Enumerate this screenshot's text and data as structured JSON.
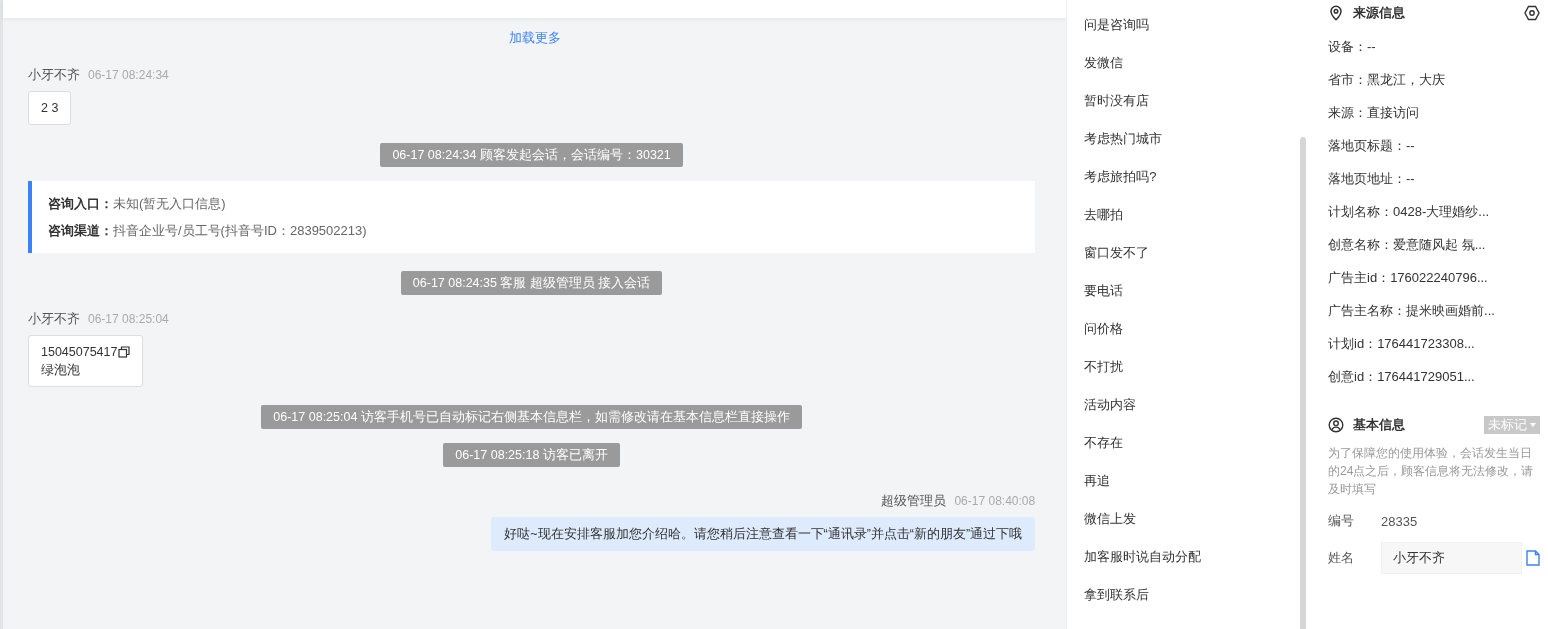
{
  "chat": {
    "load_more": "加载更多",
    "messages": [
      {
        "kind": "customer",
        "sender": "小牙不齐",
        "time": "06-17 08:24:34",
        "lines": [
          "2 3"
        ]
      },
      {
        "kind": "system",
        "text": "06-17 08:24:34 顾客发起会话，会话编号：30321"
      },
      {
        "kind": "info",
        "rows": [
          {
            "label": "咨询入口：",
            "value": "未知(暂无入口信息)"
          },
          {
            "label": "咨询渠道：",
            "value": "抖音企业号/员工号(抖音号ID：2839502213)"
          }
        ]
      },
      {
        "kind": "system",
        "text": "06-17 08:24:35 客服 超级管理员 接入会话"
      },
      {
        "kind": "customer",
        "sender": "小牙不齐",
        "time": "06-17 08:25:04",
        "lines": [
          "15045075417",
          "绿泡泡"
        ],
        "copyable": true
      },
      {
        "kind": "system",
        "text": "06-17 08:25:04 访客手机号已自动标记右侧基本信息栏，如需修改请在基本信息栏直接操作"
      },
      {
        "kind": "system",
        "text": "06-17 08:25:18 访客已离开"
      },
      {
        "kind": "agent",
        "sender": "超级管理员",
        "time": "06-17 08:40:08",
        "lines": [
          "好哒~现在安排客服加您介绍哈。请您稍后注意查看一下“通讯录”并点击“新的朋友”通过下哦"
        ]
      }
    ]
  },
  "quick_replies": [
    "问是咨询吗",
    "发微信",
    "暂时没有店",
    "考虑热门城市",
    "考虑旅拍吗?",
    "去哪拍",
    "窗口发不了",
    "要电话",
    "问价格",
    "不打扰",
    "活动内容",
    "不存在",
    "再追",
    "微信上发",
    "加客服时说自动分配",
    "拿到联系后"
  ],
  "source_info": {
    "title": "来源信息",
    "rows": [
      "设备：--",
      "省市：黑龙江，大庆",
      "来源：直接访问",
      "落地页标题：--",
      "落地页地址：--",
      "计划名称：0428-大理婚纱...",
      "创意名称：爱意随风起 氛...",
      "广告主id：176022240796...",
      "广告主名称：提米映画婚前...",
      "计划id：176441723308...",
      "创意id：176441729051..."
    ]
  },
  "basic_info": {
    "title": "基本信息",
    "tag": "未标记",
    "notice": "为了保障您的使用体验，会话发生当日的24点之后，顾客信息将无法修改，请及时填写",
    "fields": [
      {
        "kind": "text",
        "label": "编号",
        "value": "28335"
      },
      {
        "kind": "input",
        "label": "姓名",
        "value": "小牙不齐"
      }
    ]
  }
}
